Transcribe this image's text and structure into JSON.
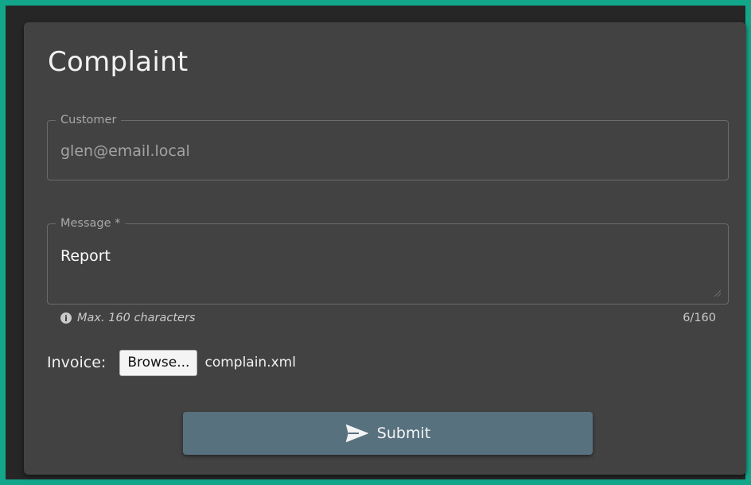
{
  "form": {
    "title": "Complaint",
    "customer": {
      "label": "Customer",
      "value": "glen@email.local"
    },
    "message": {
      "label": "Message *",
      "value": "Report",
      "hint": "Max. 160 characters",
      "counter": "6/160"
    },
    "invoice": {
      "label": "Invoice:",
      "browse_label": "Browse...",
      "file_name": "complain.xml"
    },
    "submit": {
      "label": "Submit",
      "icon": "send-icon"
    }
  },
  "colors": {
    "frame_border": "#12a68a",
    "card_background": "#424242",
    "submit_background": "#57717e"
  }
}
